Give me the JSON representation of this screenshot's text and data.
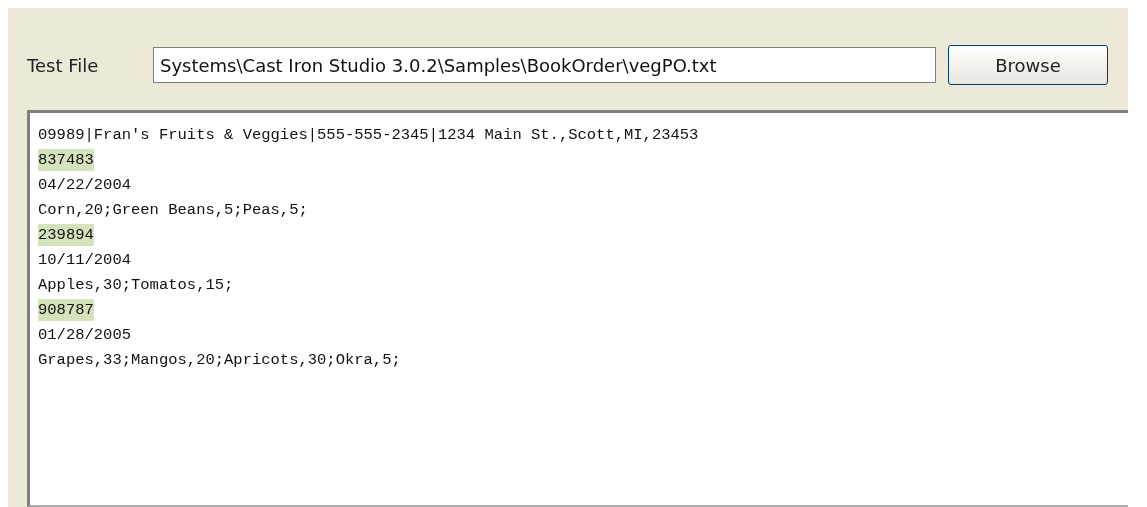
{
  "test_file": {
    "label": "Test File",
    "value": "Systems\\Cast Iron Studio 3.0.2\\Samples\\BookOrder\\vegPO.txt"
  },
  "browse_button": "Browse",
  "file_content": [
    {
      "text": "09989|Fran's Fruits & Veggies|555-555-2345|1234 Main St.,Scott,MI,23453",
      "highlighted": false
    },
    {
      "text": "837483",
      "highlighted": true
    },
    {
      "text": "04/22/2004",
      "highlighted": false
    },
    {
      "text": "Corn,20;Green Beans,5;Peas,5;",
      "highlighted": false
    },
    {
      "text": "239894",
      "highlighted": true
    },
    {
      "text": "10/11/2004",
      "highlighted": false
    },
    {
      "text": "Apples,30;Tomatos,15;",
      "highlighted": false
    },
    {
      "text": "908787",
      "highlighted": true
    },
    {
      "text": "01/28/2005",
      "highlighted": false
    },
    {
      "text": "Grapes,33;Mangos,20;Apricots,30;Okra,5;",
      "highlighted": false
    }
  ]
}
